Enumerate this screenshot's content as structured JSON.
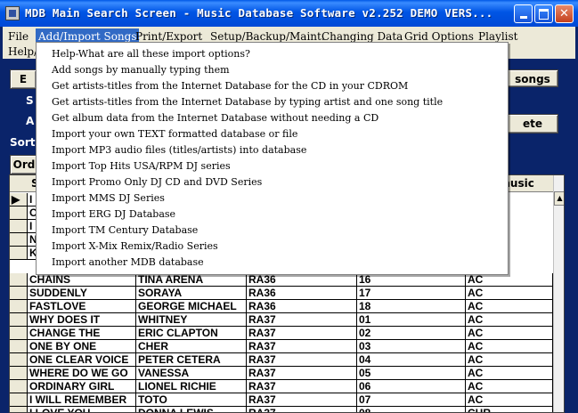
{
  "window": {
    "title": "MDB Main Search Screen - Music Database Software v2.252 DEMO VERS..."
  },
  "menubar": {
    "items": [
      {
        "label": "File"
      },
      {
        "label": "Add/Import Songs"
      },
      {
        "label": "Print/Export"
      },
      {
        "label": "Setup/Backup/Maint."
      },
      {
        "label": "Changing Data"
      },
      {
        "label": "Grid Options"
      },
      {
        "label": "Playlist"
      },
      {
        "label": "Help/"
      }
    ]
  },
  "form": {
    "left_labels": [
      "E",
      "S",
      "A",
      "Sort"
    ],
    "songs_button": "songs",
    "delete_button": "ete",
    "order_button": "Ord"
  },
  "dropdown": {
    "items": [
      "Help-What are all these import options?",
      "Add songs by manually typing them",
      "Get artists-titles from the Internet Database for the CD in your CDROM",
      "Get artists-titles from the Internet Database by typing artist and one song title",
      "Get album data from the Internet Database without needing a CD",
      "Import your own TEXT formatted database or file",
      "Import MP3 audio files (titles/artists) into database",
      "Import Top Hits USA/RPM DJ series",
      "Import Promo Only DJ CD and DVD Series",
      "Import MMS DJ Series",
      "Import ERG DJ Database",
      "Import TM Century Database",
      "Import X-Mix Remix/Radio Series",
      "Import another MDB database"
    ]
  },
  "grid": {
    "header_partial": [
      "S",
      "f music"
    ],
    "partial_rows": [
      "I",
      "C",
      "I",
      "N",
      "K"
    ],
    "rows": [
      [
        "CHAINS",
        "TINA ARENA",
        "RA36",
        "16",
        "AC"
      ],
      [
        "SUDDENLY",
        "SORAYA",
        "RA36",
        "17",
        "AC"
      ],
      [
        "FASTLOVE",
        "GEORGE MICHAEL",
        "RA36",
        "18",
        "AC"
      ],
      [
        "WHY DOES IT",
        "WHITNEY",
        "RA37",
        "01",
        "AC"
      ],
      [
        "CHANGE THE",
        "ERIC CLAPTON",
        "RA37",
        "02",
        "AC"
      ],
      [
        "ONE BY ONE",
        "CHER",
        "RA37",
        "03",
        "AC"
      ],
      [
        "ONE CLEAR VOICE",
        "PETER CETERA",
        "RA37",
        "04",
        "AC"
      ],
      [
        "WHERE DO WE GO",
        "VANESSA",
        "RA37",
        "05",
        "AC"
      ],
      [
        "ORDINARY GIRL",
        "LIONEL RICHIE",
        "RA37",
        "06",
        "AC"
      ],
      [
        "I WILL REMEMBER",
        "TOTO",
        "RA37",
        "07",
        "AC"
      ],
      [
        "I LOVE YOU",
        "DONNA LEWIS",
        "RA37",
        "08",
        "CHR"
      ]
    ]
  }
}
